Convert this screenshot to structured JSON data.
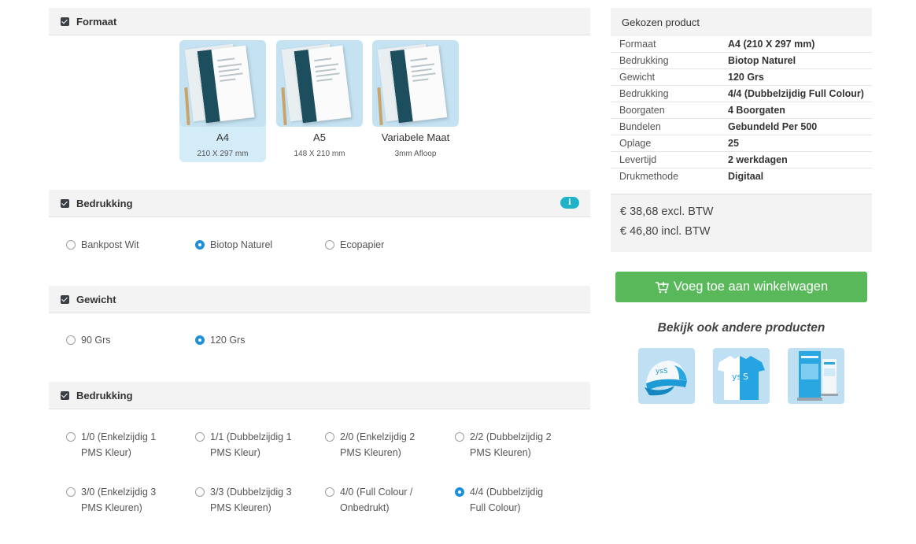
{
  "sections": {
    "formaat": {
      "title": "Formaat",
      "cards": [
        {
          "name": "A4",
          "size": "210 X 297 mm",
          "selected": true
        },
        {
          "name": "A5",
          "size": "148 X 210 mm",
          "selected": false
        },
        {
          "name": "Variabele Maat",
          "size": "3mm Afloop",
          "selected": false
        }
      ]
    },
    "bedrukking_paper": {
      "title": "Bedrukking",
      "info_badge": "i",
      "options": [
        {
          "label": "Bankpost Wit",
          "selected": false
        },
        {
          "label": "Biotop Naturel",
          "selected": true
        },
        {
          "label": "Ecopapier",
          "selected": false
        }
      ]
    },
    "gewicht": {
      "title": "Gewicht",
      "options": [
        {
          "label": "90 Grs",
          "selected": false
        },
        {
          "label": "120 Grs",
          "selected": true
        }
      ]
    },
    "bedrukking_print": {
      "title": "Bedrukking",
      "options": [
        {
          "label": "1/0 (Enkelzijdig 1 PMS Kleur)",
          "selected": false
        },
        {
          "label": "1/1 (Dubbelzijdig 1 PMS Kleur)",
          "selected": false
        },
        {
          "label": "2/0 (Enkelzijdig 2 PMS Kleuren)",
          "selected": false
        },
        {
          "label": "2/2 (Dubbelzijdig 2 PMS Kleuren)",
          "selected": false
        },
        {
          "label": "3/0 (Enkelzijdig 3 PMS Kleuren)",
          "selected": false
        },
        {
          "label": "3/3 (Dubbelzijdig 3 PMS Kleuren)",
          "selected": false
        },
        {
          "label": "4/0 (Full Colour / Onbedrukt)",
          "selected": false
        },
        {
          "label": "4/4 (Dubbelzijdig Full Colour)",
          "selected": true
        }
      ]
    }
  },
  "summary": {
    "title": "Gekozen product",
    "rows": [
      {
        "key": "Formaat",
        "value": "A4 (210 X 297 mm)"
      },
      {
        "key": "Bedrukking",
        "value": "Biotop Naturel"
      },
      {
        "key": "Gewicht",
        "value": "120 Grs"
      },
      {
        "key": "Bedrukking",
        "value": "4/4 (Dubbelzijdig Full Colour)"
      },
      {
        "key": "Boorgaten",
        "value": "4 Boorgaten"
      },
      {
        "key": "Bundelen",
        "value": "Gebundeld Per 500"
      },
      {
        "key": "Oplage",
        "value": "25"
      },
      {
        "key": "Levertijd",
        "value": "2 werkdagen"
      },
      {
        "key": "Drukmethode",
        "value": "Digitaal"
      }
    ],
    "price_excl": "€ 38,68 excl. BTW",
    "price_incl": "€ 46,80 incl. BTW"
  },
  "cart_button": {
    "label": "Voeg toe aan winkelwagen",
    "icon": "cart-plus-icon"
  },
  "other_products": {
    "title": "Bekijk ook andere producten",
    "items": [
      {
        "icon": "cap-product-icon"
      },
      {
        "icon": "tshirt-product-icon"
      },
      {
        "icon": "rollup-banner-product-icon"
      }
    ]
  },
  "colors": {
    "accent": "#1e8fd9",
    "button_green": "#58b85a",
    "info_badge": "#1fb2c8",
    "selected_card": "#d4ebf8",
    "header_bg": "#f3f3f3"
  }
}
